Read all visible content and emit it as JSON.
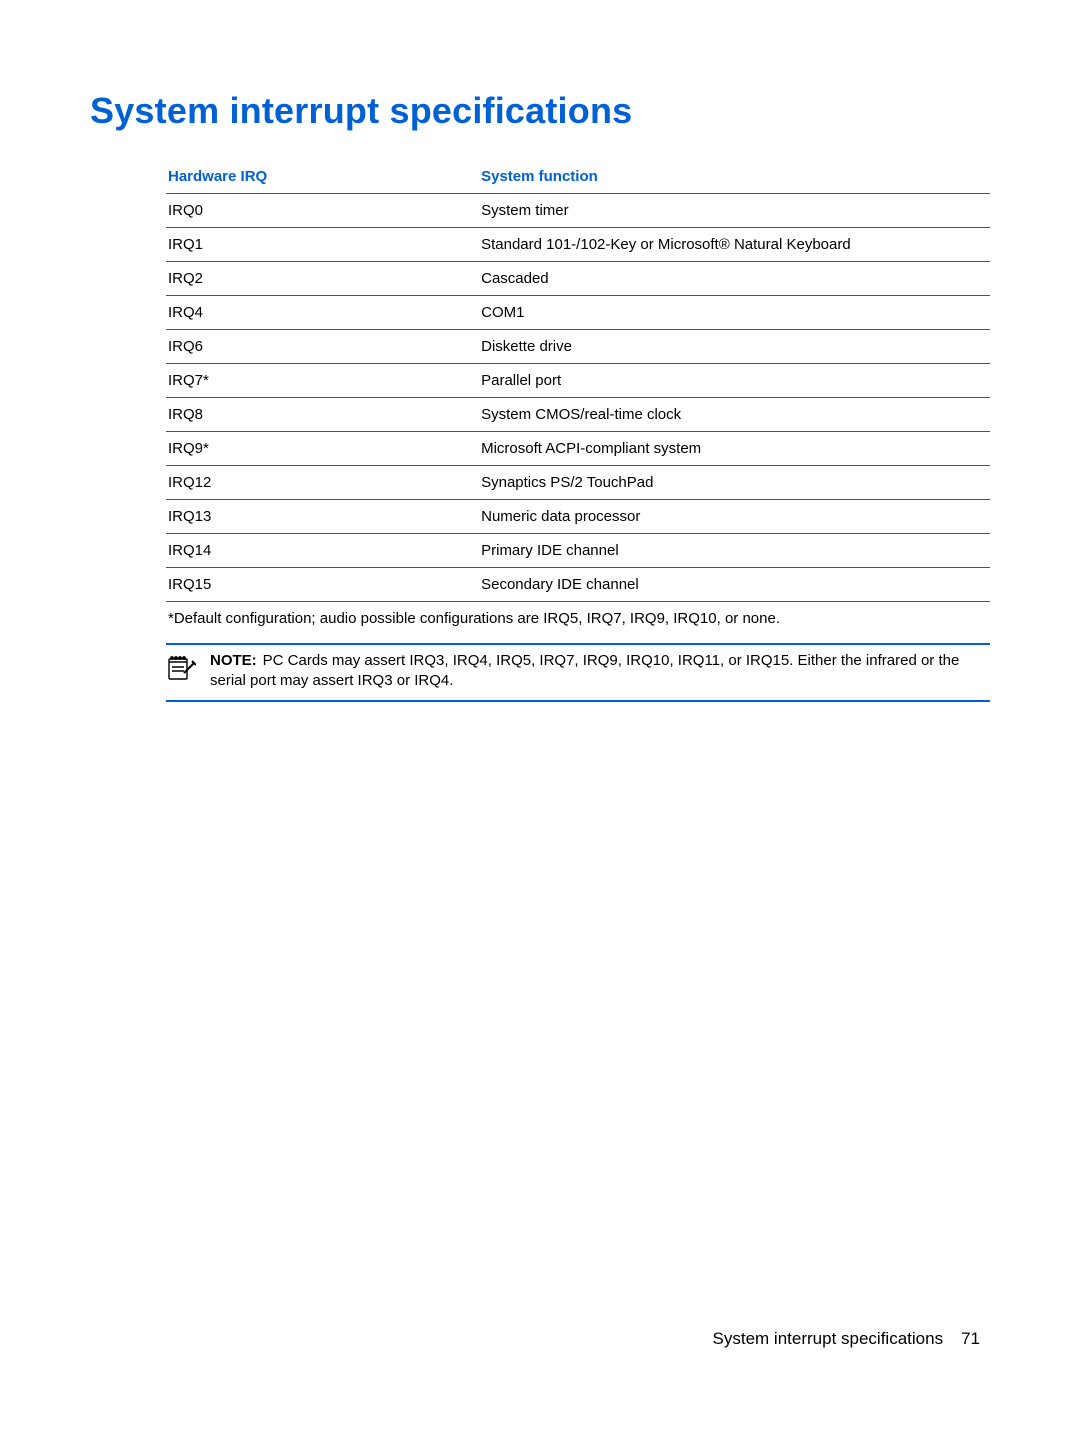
{
  "title": "System interrupt specifications",
  "table": {
    "headers": {
      "left": "Hardware IRQ",
      "right": "System function"
    },
    "rows": [
      {
        "irq": "IRQ0",
        "func": "System timer"
      },
      {
        "irq": "IRQ1",
        "func": "Standard 101-/102-Key or Microsoft® Natural Keyboard"
      },
      {
        "irq": "IRQ2",
        "func": "Cascaded"
      },
      {
        "irq": "IRQ4",
        "func": "COM1"
      },
      {
        "irq": "IRQ6",
        "func": "Diskette drive"
      },
      {
        "irq": "IRQ7*",
        "func": "Parallel port"
      },
      {
        "irq": "IRQ8",
        "func": "System CMOS/real-time clock"
      },
      {
        "irq": "IRQ9*",
        "func": "Microsoft ACPI-compliant system"
      },
      {
        "irq": "IRQ12",
        "func": "Synaptics PS/2 TouchPad"
      },
      {
        "irq": "IRQ13",
        "func": "Numeric data processor"
      },
      {
        "irq": "IRQ14",
        "func": "Primary IDE channel"
      },
      {
        "irq": "IRQ15",
        "func": "Secondary IDE channel"
      }
    ],
    "footnote": "*Default configuration; audio possible configurations are IRQ5, IRQ7, IRQ9, IRQ10, or none."
  },
  "note": {
    "label": "NOTE:",
    "text": "PC Cards may assert IRQ3, IRQ4, IRQ5, IRQ7, IRQ9, IRQ10, IRQ11, or IRQ15. Either the infrared or the serial port may assert IRQ3 or IRQ4."
  },
  "footer": {
    "title": "System interrupt specifications",
    "page": "71"
  }
}
